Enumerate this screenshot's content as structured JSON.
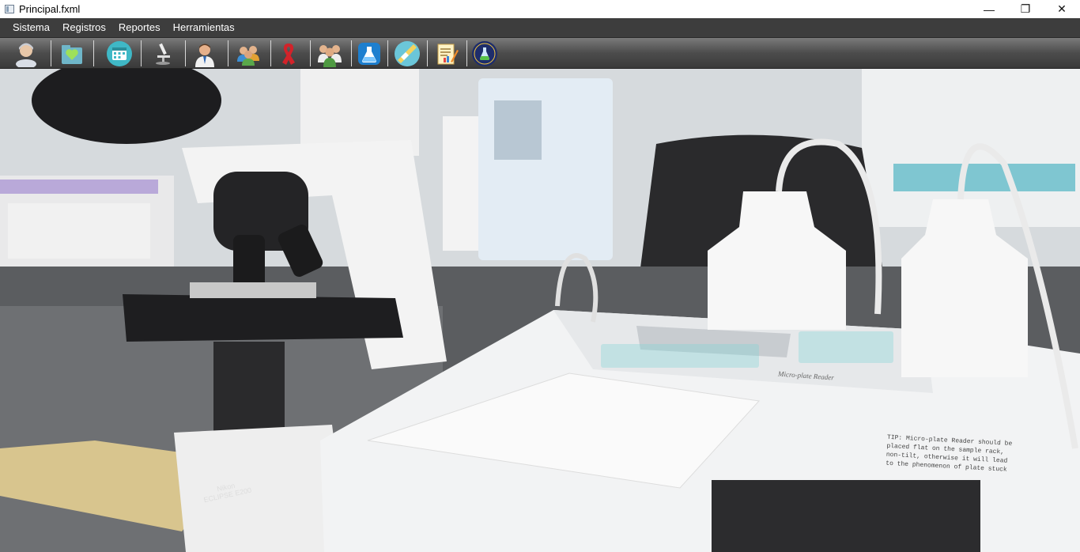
{
  "window": {
    "title": "Principal.fxml",
    "controls": [
      "—",
      "❐",
      "✕"
    ]
  },
  "menu": [
    "Sistema",
    "Registros",
    "Reportes",
    "Herramientas"
  ],
  "toolbar": {
    "buttons": [
      {
        "icon": "patient-icon"
      },
      {
        "icon": "health-folder-icon"
      },
      {
        "icon": "calendar-icon"
      },
      {
        "icon": "microscope-icon"
      },
      {
        "icon": "doctor-icon"
      },
      {
        "icon": "group-icon"
      },
      {
        "icon": "ribbon-icon"
      },
      {
        "icon": "staff-icon"
      },
      {
        "icon": "flask-icon"
      },
      {
        "icon": "test-strip-icon"
      },
      {
        "icon": "report-notes-icon"
      },
      {
        "icon": "lab-logo-icon"
      }
    ]
  },
  "background": {
    "tip_text": "TIP: Micro-plate Reader should be placed flat on the sample rack, non-tilt, otherwise it will lead to the phenomenon of plate stuck",
    "device_label": "Micro-plate Reader",
    "microscope_brand": "Nikon",
    "microscope_model": "ECLIPSE E200"
  }
}
